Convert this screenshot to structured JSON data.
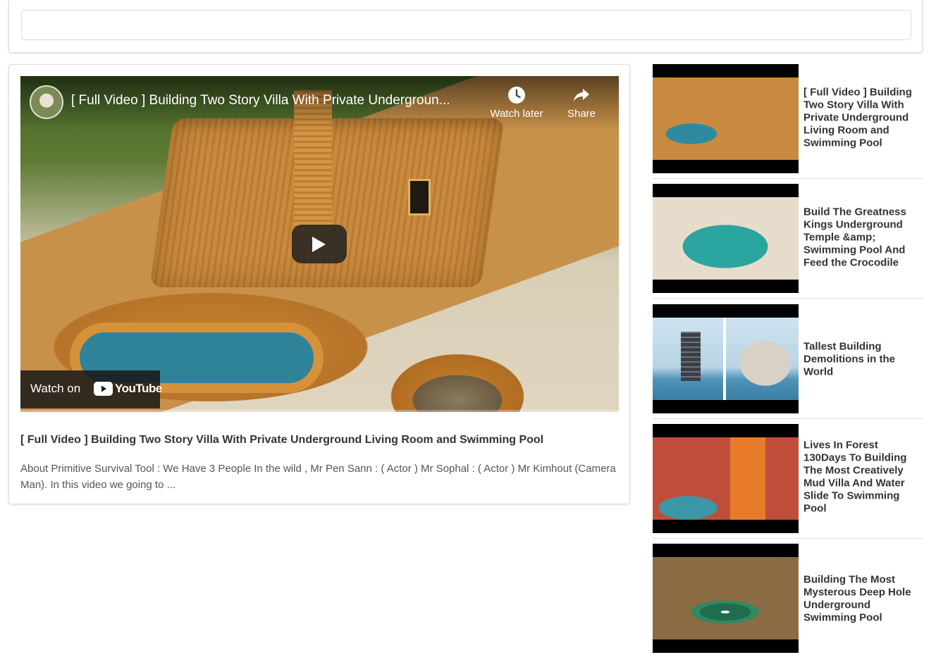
{
  "search": {
    "value": "",
    "placeholder": ""
  },
  "player": {
    "title": "[ Full Video ] Building Two Story Villa With Private Undergroun...",
    "watch_later_label": "Watch later",
    "share_label": "Share",
    "watch_on_label": "Watch on",
    "youtube_logo_text": "YouTube",
    "icons": {
      "watch_later": "clock-icon",
      "share": "share-arrow-icon",
      "play": "play-icon",
      "logo": "youtube-logo"
    },
    "colors": {
      "play_button_bg": "#212121",
      "overlay_text": "#ffffff"
    }
  },
  "video": {
    "title": "[ Full Video ] Building Two Story Villa With Private Underground Living Room and Swimming Pool",
    "description": "About Primitive Survival Tool : We Have 3 People In the wild , Mr Pen Sann : ( Actor ) Mr Sophal : ( Actor ) Mr Kimhout (Camera Man). In this video we going to ..."
  },
  "related": [
    {
      "title": "[ Full Video ] Building Two Story Villa With Private Underground Living Room and Swimming Pool"
    },
    {
      "title": "Build The Greatness Kings Underground Temple &amp; Swimming Pool And Feed the Crocodile"
    },
    {
      "title": "Tallest Building Demolitions in the World"
    },
    {
      "title": "Lives In Forest 130Days To Building The Most Creatively Mud Villa And Water Slide To Swimming Pool"
    },
    {
      "title": "Building The Most Mysterous Deep Hole Underground Swimming Pool"
    }
  ]
}
